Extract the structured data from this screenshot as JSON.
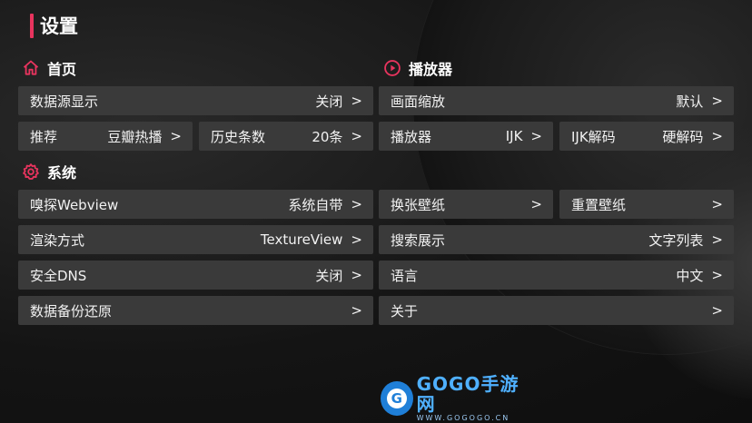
{
  "page_title": "设置",
  "colors": {
    "accent": "#e8345e",
    "row_bg": "#3a3a3a",
    "logo_blue": "#1f7fd8"
  },
  "sections": {
    "home": {
      "title": "首页",
      "icon": "home-icon"
    },
    "player": {
      "title": "播放器",
      "icon": "play-circle-icon"
    },
    "system": {
      "title": "系统",
      "icon": "gear-icon"
    }
  },
  "rows": {
    "datasource": {
      "label": "数据源显示",
      "value": "关闭",
      "chevron": ">"
    },
    "recommend": {
      "label": "推荐",
      "value": "豆瓣热播",
      "chevron": ">"
    },
    "history": {
      "label": "历史条数",
      "value": "20条",
      "chevron": ">"
    },
    "zoom": {
      "label": "画面缩放",
      "value": "默认",
      "chevron": ">"
    },
    "player": {
      "label": "播放器",
      "value": "IJK",
      "chevron": ">"
    },
    "ijk_decode": {
      "label": "IJK解码",
      "value": "硬解码",
      "chevron": ">"
    },
    "sniff": {
      "label": "嗅探Webview",
      "value": "系统自带",
      "chevron": ">"
    },
    "render": {
      "label": "渲染方式",
      "value": "TextureView",
      "chevron": ">"
    },
    "dns": {
      "label": "安全DNS",
      "value": "关闭",
      "chevron": ">"
    },
    "backup": {
      "label": "数据备份还原",
      "value": "",
      "chevron": ">"
    },
    "wallpaper_change": {
      "label": "换张壁纸",
      "value": "",
      "chevron": ">"
    },
    "wallpaper_reset": {
      "label": "重置壁纸",
      "value": "",
      "chevron": ">"
    },
    "search_display": {
      "label": "搜索展示",
      "value": "文字列表",
      "chevron": ">"
    },
    "language": {
      "label": "语言",
      "value": "中文",
      "chevron": ">"
    },
    "about": {
      "label": "关于",
      "value": "",
      "chevron": ">"
    }
  },
  "watermark": {
    "brand": "GOGO手游网",
    "url": "WWW.GOGOGO.CN",
    "mark": "G"
  }
}
